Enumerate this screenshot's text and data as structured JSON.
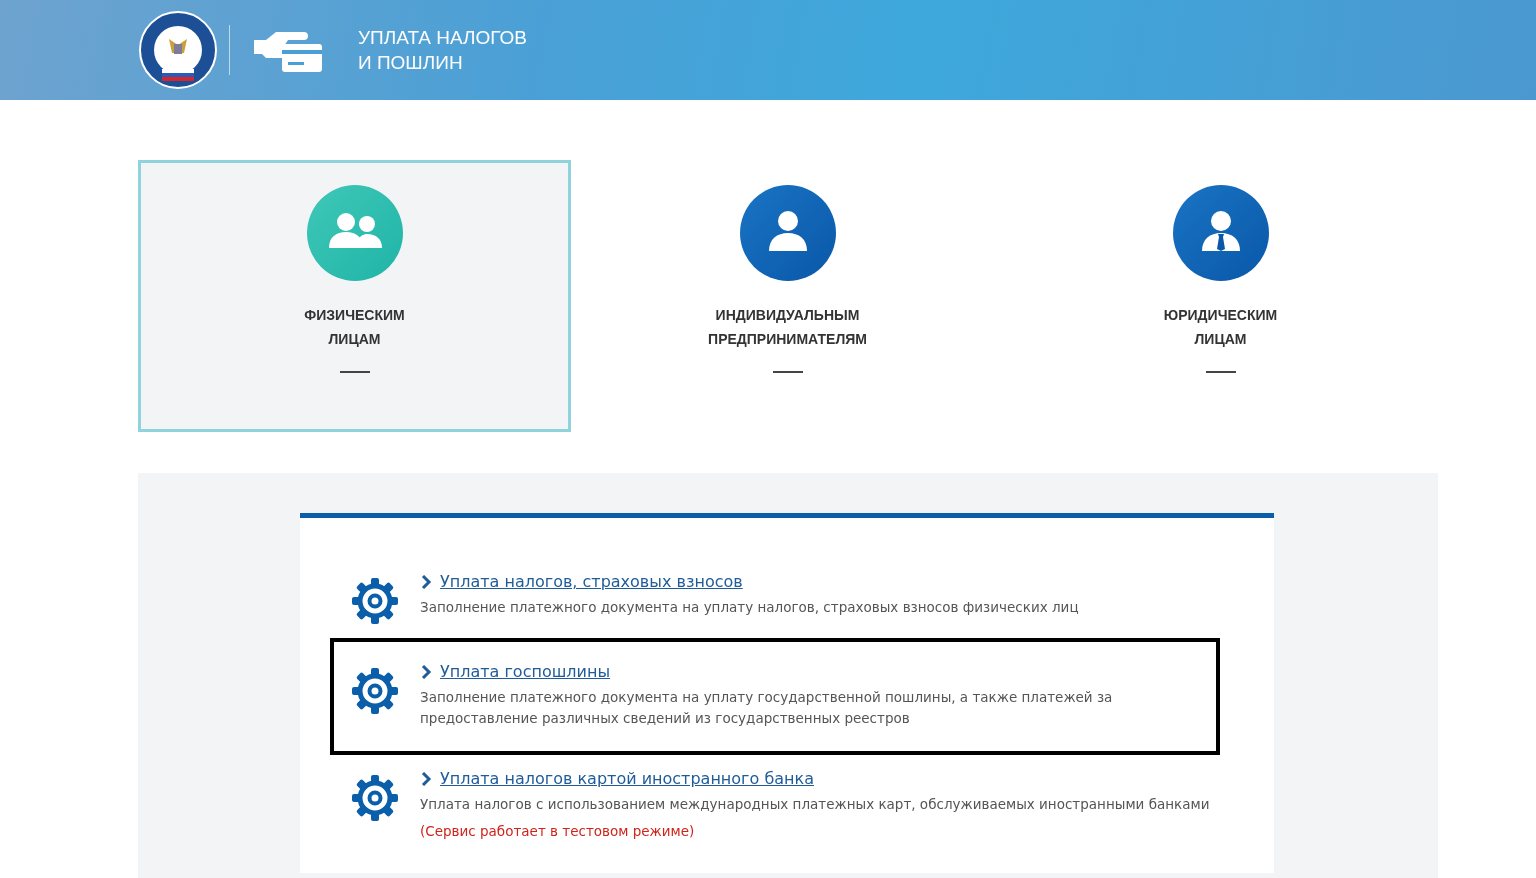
{
  "header": {
    "title_lines": [
      "УПЛАТА НАЛОГОВ",
      "И ПОШЛИН"
    ]
  },
  "categories": [
    {
      "kind": "group",
      "label_lines": [
        "ФИЗИЧЕСКИМ",
        "ЛИЦАМ"
      ],
      "selected": true
    },
    {
      "kind": "person",
      "label_lines": [
        "ИНДИВИДУАЛЬНЫМ",
        "ПРЕДПРИНИМАТЕЛЯМ"
      ],
      "selected": false
    },
    {
      "kind": "business",
      "label_lines": [
        "ЮРИДИЧЕСКИМ",
        "ЛИЦАМ"
      ],
      "selected": false
    }
  ],
  "services": [
    {
      "title": "Уплата налогов, страховых взносов",
      "description": "Заполнение платежного документа на уплату налогов, страховых взносов физических лиц",
      "highlighted": false
    },
    {
      "title": "Уплата госпошлины",
      "description": "Заполнение платежного документа на уплату государственной пошлины, а также платежей за предоставление различных сведений из государственных реестров",
      "highlighted": true
    },
    {
      "title": "Уплата налогов картой иностранного банка",
      "description": "Уплата налогов с использованием международных платежных карт, обслуживаемых иностранными банками",
      "note": "(Сервис работает в тестовом режиме)",
      "highlighted": false
    }
  ]
}
